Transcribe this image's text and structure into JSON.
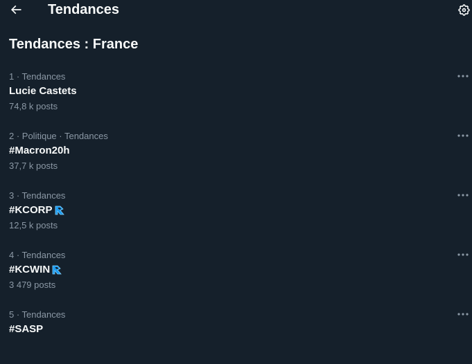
{
  "header": {
    "title": "Tendances",
    "back_icon": "arrow-left-icon",
    "settings_icon": "gear-icon"
  },
  "section": {
    "title": "Tendances : France"
  },
  "trends": [
    {
      "meta": "1 · Tendances",
      "name": "Lucie Castets",
      "count": "74,8 k posts",
      "badge": false
    },
    {
      "meta": "2 · Politique · Tendances",
      "name": "#Macron20h",
      "count": "37,7 k posts",
      "badge": false
    },
    {
      "meta": "3 · Tendances",
      "name": "#KCORP",
      "count": "12,5 k posts",
      "badge": true
    },
    {
      "meta": "4 · Tendances",
      "name": "#KCWIN",
      "count": "3 479 posts",
      "badge": true
    },
    {
      "meta": "5 · Tendances",
      "name": "#SASP",
      "count": "",
      "badge": false
    }
  ],
  "colors": {
    "background": "#15202b",
    "text_primary": "#f7f9f9",
    "text_secondary": "#8b98a5",
    "badge": "#1d9bf0"
  }
}
